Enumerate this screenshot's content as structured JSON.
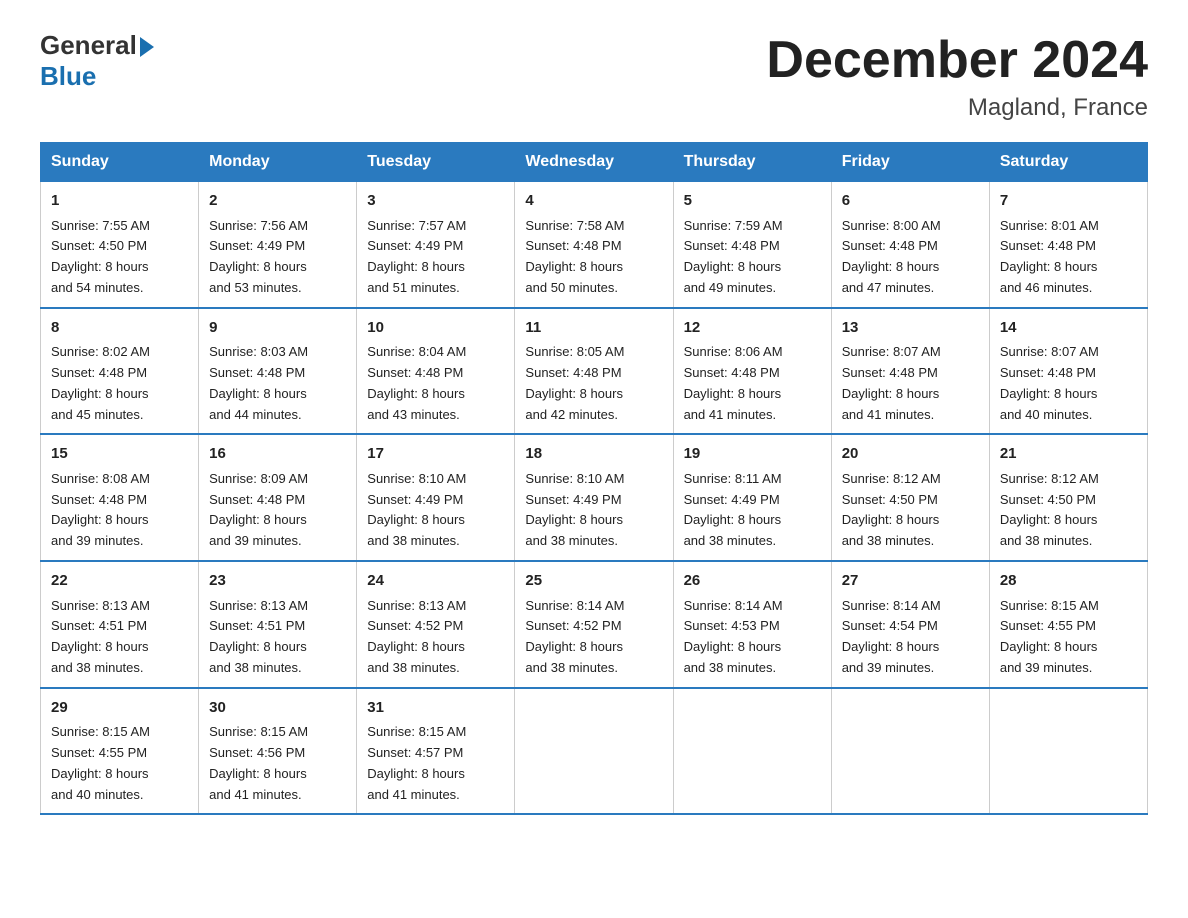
{
  "header": {
    "logo_general": "General",
    "logo_blue": "Blue",
    "title": "December 2024",
    "subtitle": "Magland, France"
  },
  "days_of_week": [
    "Sunday",
    "Monday",
    "Tuesday",
    "Wednesday",
    "Thursday",
    "Friday",
    "Saturday"
  ],
  "weeks": [
    [
      {
        "day": "1",
        "sunrise": "7:55 AM",
        "sunset": "4:50 PM",
        "daylight": "8 hours and 54 minutes."
      },
      {
        "day": "2",
        "sunrise": "7:56 AM",
        "sunset": "4:49 PM",
        "daylight": "8 hours and 53 minutes."
      },
      {
        "day": "3",
        "sunrise": "7:57 AM",
        "sunset": "4:49 PM",
        "daylight": "8 hours and 51 minutes."
      },
      {
        "day": "4",
        "sunrise": "7:58 AM",
        "sunset": "4:48 PM",
        "daylight": "8 hours and 50 minutes."
      },
      {
        "day": "5",
        "sunrise": "7:59 AM",
        "sunset": "4:48 PM",
        "daylight": "8 hours and 49 minutes."
      },
      {
        "day": "6",
        "sunrise": "8:00 AM",
        "sunset": "4:48 PM",
        "daylight": "8 hours and 47 minutes."
      },
      {
        "day": "7",
        "sunrise": "8:01 AM",
        "sunset": "4:48 PM",
        "daylight": "8 hours and 46 minutes."
      }
    ],
    [
      {
        "day": "8",
        "sunrise": "8:02 AM",
        "sunset": "4:48 PM",
        "daylight": "8 hours and 45 minutes."
      },
      {
        "day": "9",
        "sunrise": "8:03 AM",
        "sunset": "4:48 PM",
        "daylight": "8 hours and 44 minutes."
      },
      {
        "day": "10",
        "sunrise": "8:04 AM",
        "sunset": "4:48 PM",
        "daylight": "8 hours and 43 minutes."
      },
      {
        "day": "11",
        "sunrise": "8:05 AM",
        "sunset": "4:48 PM",
        "daylight": "8 hours and 42 minutes."
      },
      {
        "day": "12",
        "sunrise": "8:06 AM",
        "sunset": "4:48 PM",
        "daylight": "8 hours and 41 minutes."
      },
      {
        "day": "13",
        "sunrise": "8:07 AM",
        "sunset": "4:48 PM",
        "daylight": "8 hours and 41 minutes."
      },
      {
        "day": "14",
        "sunrise": "8:07 AM",
        "sunset": "4:48 PM",
        "daylight": "8 hours and 40 minutes."
      }
    ],
    [
      {
        "day": "15",
        "sunrise": "8:08 AM",
        "sunset": "4:48 PM",
        "daylight": "8 hours and 39 minutes."
      },
      {
        "day": "16",
        "sunrise": "8:09 AM",
        "sunset": "4:48 PM",
        "daylight": "8 hours and 39 minutes."
      },
      {
        "day": "17",
        "sunrise": "8:10 AM",
        "sunset": "4:49 PM",
        "daylight": "8 hours and 38 minutes."
      },
      {
        "day": "18",
        "sunrise": "8:10 AM",
        "sunset": "4:49 PM",
        "daylight": "8 hours and 38 minutes."
      },
      {
        "day": "19",
        "sunrise": "8:11 AM",
        "sunset": "4:49 PM",
        "daylight": "8 hours and 38 minutes."
      },
      {
        "day": "20",
        "sunrise": "8:12 AM",
        "sunset": "4:50 PM",
        "daylight": "8 hours and 38 minutes."
      },
      {
        "day": "21",
        "sunrise": "8:12 AM",
        "sunset": "4:50 PM",
        "daylight": "8 hours and 38 minutes."
      }
    ],
    [
      {
        "day": "22",
        "sunrise": "8:13 AM",
        "sunset": "4:51 PM",
        "daylight": "8 hours and 38 minutes."
      },
      {
        "day": "23",
        "sunrise": "8:13 AM",
        "sunset": "4:51 PM",
        "daylight": "8 hours and 38 minutes."
      },
      {
        "day": "24",
        "sunrise": "8:13 AM",
        "sunset": "4:52 PM",
        "daylight": "8 hours and 38 minutes."
      },
      {
        "day": "25",
        "sunrise": "8:14 AM",
        "sunset": "4:52 PM",
        "daylight": "8 hours and 38 minutes."
      },
      {
        "day": "26",
        "sunrise": "8:14 AM",
        "sunset": "4:53 PM",
        "daylight": "8 hours and 38 minutes."
      },
      {
        "day": "27",
        "sunrise": "8:14 AM",
        "sunset": "4:54 PM",
        "daylight": "8 hours and 39 minutes."
      },
      {
        "day": "28",
        "sunrise": "8:15 AM",
        "sunset": "4:55 PM",
        "daylight": "8 hours and 39 minutes."
      }
    ],
    [
      {
        "day": "29",
        "sunrise": "8:15 AM",
        "sunset": "4:55 PM",
        "daylight": "8 hours and 40 minutes."
      },
      {
        "day": "30",
        "sunrise": "8:15 AM",
        "sunset": "4:56 PM",
        "daylight": "8 hours and 41 minutes."
      },
      {
        "day": "31",
        "sunrise": "8:15 AM",
        "sunset": "4:57 PM",
        "daylight": "8 hours and 41 minutes."
      },
      null,
      null,
      null,
      null
    ]
  ],
  "labels": {
    "sunrise": "Sunrise:",
    "sunset": "Sunset:",
    "daylight": "Daylight:"
  }
}
